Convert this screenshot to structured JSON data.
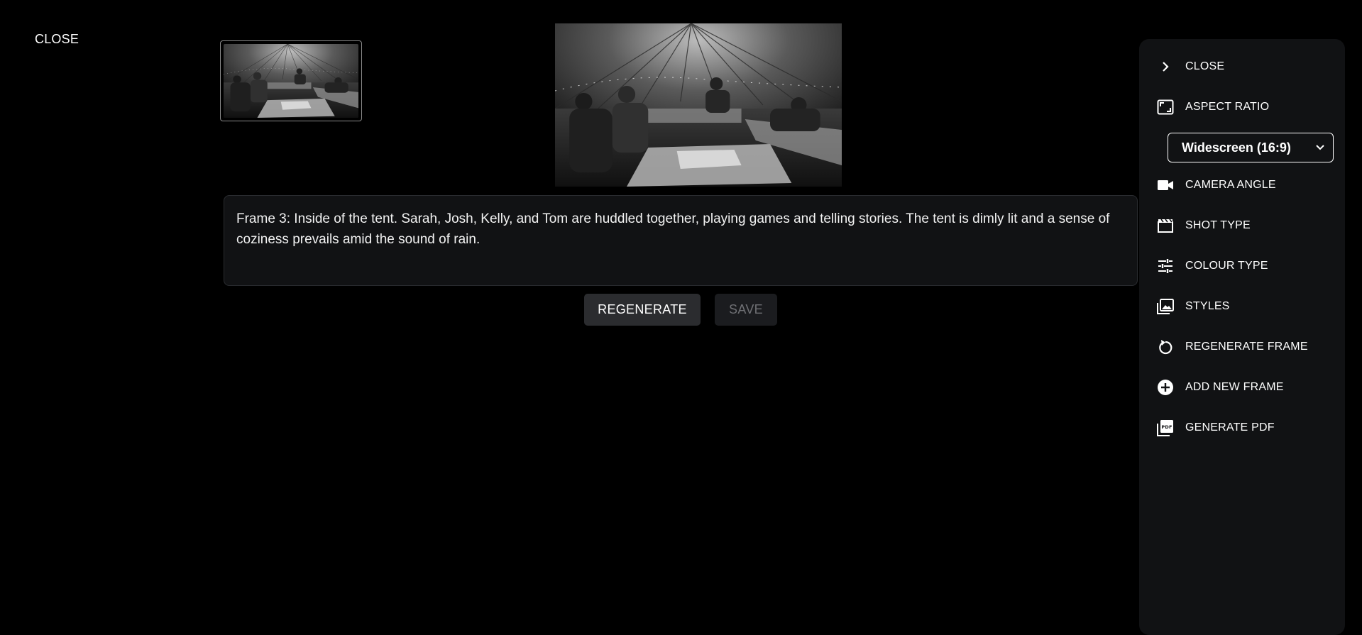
{
  "top": {
    "close_label": "CLOSE"
  },
  "prompt": {
    "text": "Frame 3: Inside of the tent. Sarah, Josh, Kelly, and Tom are huddled together, playing games and telling stories. The tent is dimly lit and a sense of coziness prevails amid the sound of rain."
  },
  "actions": {
    "regenerate_label": "REGENERATE",
    "save_label": "SAVE"
  },
  "panel": {
    "items": [
      {
        "label": "CLOSE",
        "icon": "chevron-right-icon"
      },
      {
        "label": "ASPECT RATIO",
        "icon": "aspect-ratio-icon"
      },
      {
        "label": "CAMERA ANGLE",
        "icon": "videocam-icon"
      },
      {
        "label": "SHOT TYPE",
        "icon": "clapperboard-icon"
      },
      {
        "label": "COLOUR TYPE",
        "icon": "tune-sliders-icon"
      },
      {
        "label": "STYLES",
        "icon": "photo-library-icon"
      },
      {
        "label": "REGENERATE FRAME",
        "icon": "refresh-icon"
      },
      {
        "label": "ADD NEW FRAME",
        "icon": "add-circle-icon"
      },
      {
        "label": "GENERATE PDF",
        "icon": "pdf-icon"
      }
    ],
    "aspect_ratio_value": "Widescreen (16:9)"
  },
  "colors": {
    "background": "#000000",
    "panel": "#111214",
    "button_primary": "#2b2c2f",
    "button_disabled_text": "#6f7074"
  }
}
